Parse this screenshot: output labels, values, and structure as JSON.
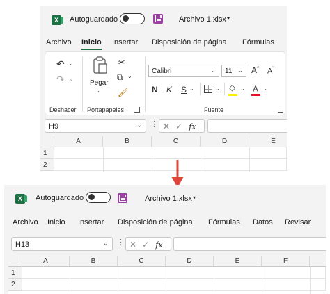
{
  "top": {
    "autosave_label": "Autoguardado",
    "file_name": "Archivo 1.xlsx",
    "tabs": [
      "Archivo",
      "Inicio",
      "Insertar",
      "Disposición de página",
      "Fórmulas"
    ],
    "active_tab": "Inicio",
    "ribbon": {
      "undo_group": "Deshacer",
      "clipboard_group": "Portapapeles",
      "paste_label": "Pegar",
      "font_group": "Fuente",
      "font_name": "Calibri",
      "font_size": "11",
      "bold": "N",
      "italic": "K",
      "underline": "S",
      "grow_font": "A",
      "shrink_font": "A",
      "font_color": "A"
    },
    "name_box": "H9",
    "fx_label": "fx",
    "columns": [
      "A",
      "B",
      "C",
      "D",
      "E"
    ],
    "rows": [
      "1",
      "2"
    ]
  },
  "bottom": {
    "autosave_label": "Autoguardado",
    "file_name": "Archivo 1.xlsx",
    "tabs": [
      "Archivo",
      "Inicio",
      "Insertar",
      "Disposición de página",
      "Fórmulas",
      "Datos",
      "Revisar"
    ],
    "name_box": "H13",
    "fx_label": "fx",
    "columns": [
      "A",
      "B",
      "C",
      "D",
      "E",
      "F"
    ],
    "rows": [
      "1",
      "2"
    ]
  },
  "colors": {
    "excel_green": "#1d7044",
    "save_purple": "#9b3fa5",
    "arrow_red": "#e0453c",
    "highlight_yellow": "#ffee00",
    "font_red": "#e81123"
  },
  "icons": [
    "excel-logo-icon",
    "save-icon",
    "undo-icon",
    "redo-icon",
    "paste-icon",
    "cut-icon",
    "copy-icon",
    "format-painter-icon",
    "borders-icon",
    "highlight-icon",
    "cancel-icon",
    "enter-icon",
    "insert-function-icon",
    "dropdown-arrow-icon"
  ]
}
